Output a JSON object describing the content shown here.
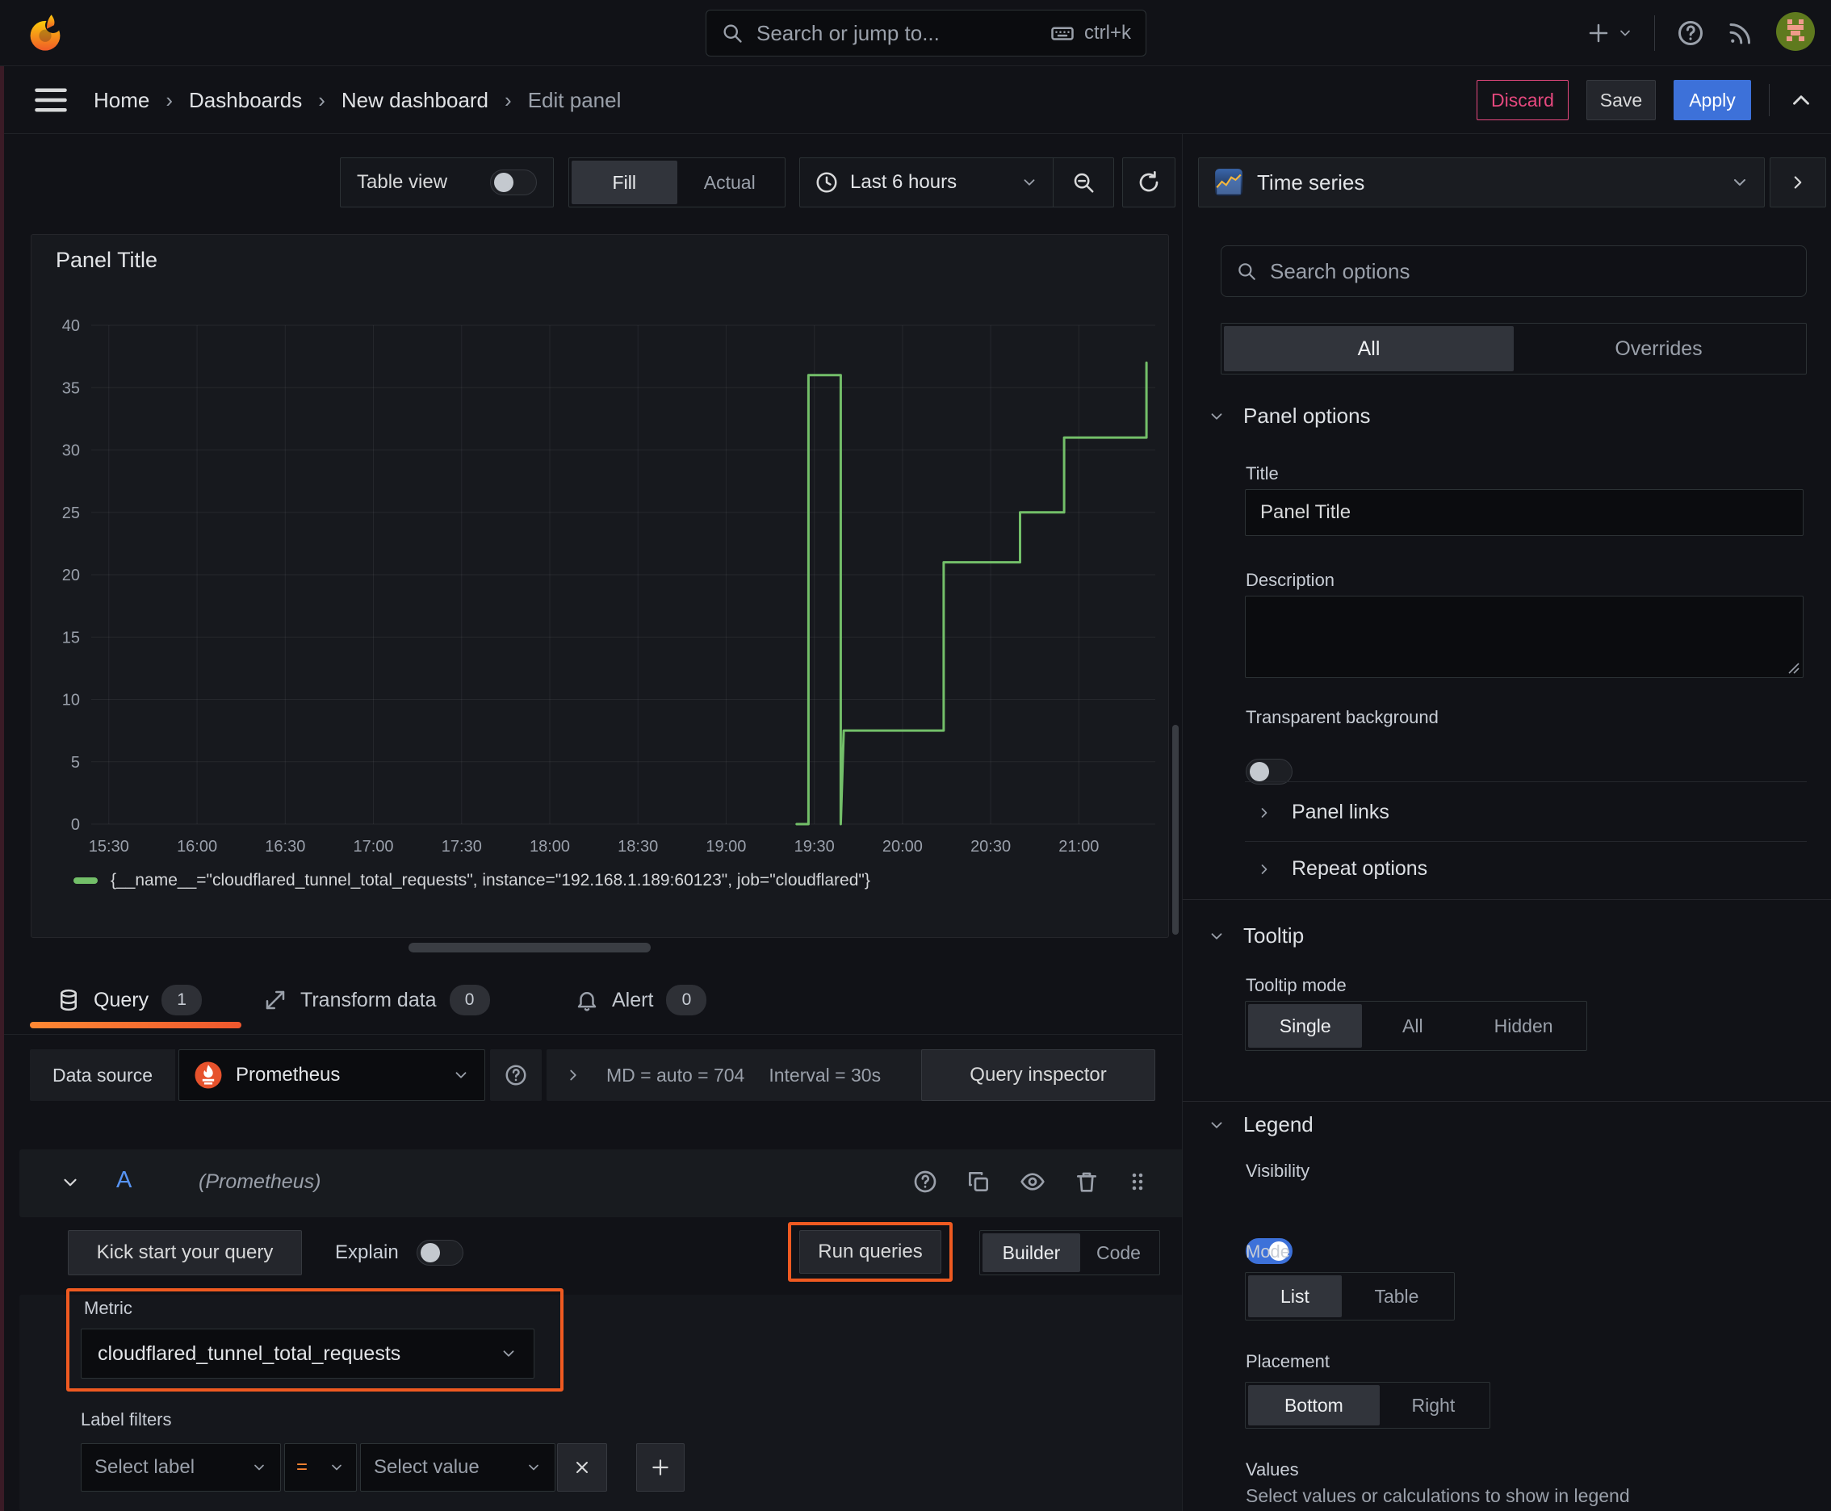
{
  "topbar": {
    "search_placeholder": "Search or jump to...",
    "shortcut": "ctrl+k"
  },
  "breadcrumb": {
    "separator": "›",
    "items": [
      "Home",
      "Dashboards",
      "New dashboard",
      "Edit panel"
    ],
    "discard_label": "Discard",
    "save_label": "Save",
    "apply_label": "Apply"
  },
  "panel_toolbar": {
    "table_view_label": "Table view",
    "fill_label": "Fill",
    "actual_label": "Actual",
    "time_range_label": "Last 6 hours"
  },
  "viz_picker": {
    "label": "Time series"
  },
  "chart_data": {
    "type": "line",
    "title": "Panel Title",
    "x_ticks": [
      "15:30",
      "16:00",
      "16:30",
      "17:00",
      "17:30",
      "18:00",
      "18:30",
      "19:00",
      "19:30",
      "20:00",
      "20:30",
      "21:00"
    ],
    "y_ticks": [
      0,
      5,
      10,
      15,
      20,
      25,
      30,
      35,
      40
    ],
    "ylim": [
      0,
      40
    ],
    "x_range_minutes": [
      924,
      1286
    ],
    "grid": true,
    "legend_position": "bottom",
    "series": [
      {
        "name": "{__name__=\"cloudflared_tunnel_total_requests\", instance=\"192.168.1.189:60123\", job=\"cloudflared\"}",
        "color": "#73BF69",
        "step": true,
        "points": [
          [
            "19:24",
            0
          ],
          [
            "19:28",
            0
          ],
          [
            "19:28",
            36
          ],
          [
            "19:39",
            36
          ],
          [
            "19:39",
            0
          ],
          [
            "19:40",
            7.5
          ],
          [
            "20:14",
            7.5
          ],
          [
            "20:14",
            21
          ],
          [
            "20:40",
            21
          ],
          [
            "20:40",
            25
          ],
          [
            "20:55",
            25
          ],
          [
            "20:55",
            31
          ],
          [
            "21:23",
            31
          ],
          [
            "21:23",
            37
          ]
        ]
      }
    ]
  },
  "tabs": {
    "query_label": "Query",
    "query_count": "1",
    "transform_label": "Transform data",
    "transform_count": "0",
    "alert_label": "Alert",
    "alert_count": "0"
  },
  "datasource": {
    "label": "Data source",
    "name": "Prometheus",
    "max_data_points": "MD = auto = 704",
    "interval": "Interval = 30s",
    "inspector_label": "Query inspector"
  },
  "query": {
    "ref_id": "A",
    "datasource_hint": "(Prometheus)",
    "kickstart_label": "Kick start your query",
    "explain_label": "Explain",
    "run_label": "Run queries",
    "builder_label": "Builder",
    "code_label": "Code",
    "metric_label": "Metric",
    "metric_value": "cloudflared_tunnel_total_requests",
    "label_filters_label": "Label filters",
    "select_label_placeholder": "Select label",
    "operator": "=",
    "select_value_placeholder": "Select value"
  },
  "options_pane": {
    "search_placeholder": "Search options",
    "tab_all": "All",
    "tab_overrides": "Overrides",
    "panel_options": {
      "header": "Panel options",
      "title_label": "Title",
      "title_value": "Panel Title",
      "description_label": "Description",
      "transparent_label": "Transparent background"
    },
    "panel_links_header": "Panel links",
    "repeat_options_header": "Repeat options",
    "tooltip": {
      "header": "Tooltip",
      "mode_label": "Tooltip mode",
      "modes": [
        "Single",
        "All",
        "Hidden"
      ]
    },
    "legend": {
      "header": "Legend",
      "visibility_label": "Visibility",
      "mode_label": "Mode",
      "modes": [
        "List",
        "Table"
      ],
      "placement_label": "Placement",
      "placements": [
        "Bottom",
        "Right"
      ],
      "values_label": "Values",
      "values_hint": "Select values or calculations to show in legend"
    }
  },
  "colors": {
    "accent_orange": "#EF5A21",
    "apply_blue": "#3D71D9",
    "discard_pink": "#E5487E",
    "series_green": "#73BF69"
  }
}
